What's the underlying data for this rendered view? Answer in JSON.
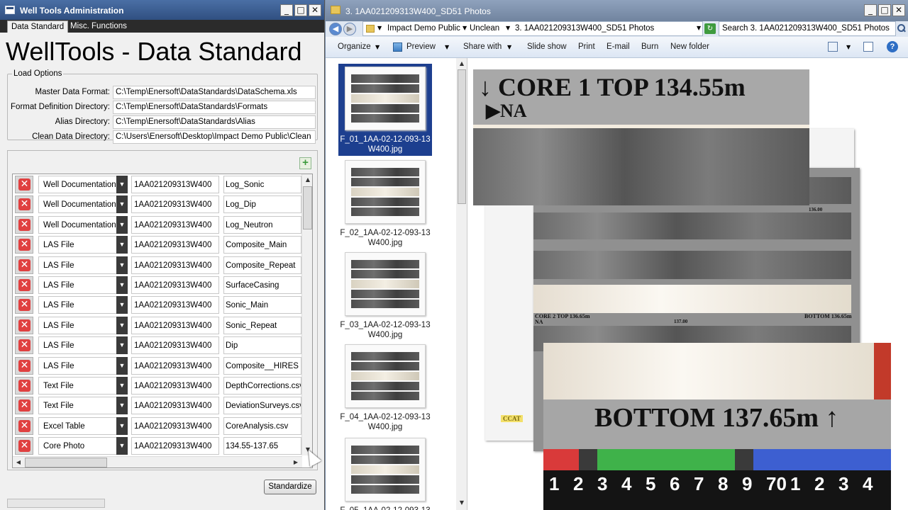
{
  "left_window": {
    "title": "Well Tools Administration",
    "tabs": [
      "Data Standard",
      "Misc. Functions"
    ],
    "app_title": "WellTools - Data Standard",
    "load_options": {
      "legend": "Load Options",
      "fields": [
        {
          "label": "Master Data Format:",
          "value": "C:\\Temp\\Enersoft\\DataStandards\\DataSchema.xls"
        },
        {
          "label": "Format Definition Directory:",
          "value": "C:\\Temp\\Enersoft\\DataStandards\\Formats"
        },
        {
          "label": "Alias Directory:",
          "value": "C:\\Temp\\Enersoft\\DataStandards\\Alias"
        },
        {
          "label": "Clean Data Directory:",
          "value": "C:\\Users\\Enersoft\\Desktop\\Impact Demo Public\\Clean"
        }
      ]
    },
    "add_button": "+",
    "rows": [
      {
        "type": "Well Documentation",
        "id": "1AA021209313W400",
        "name": "Log_Sonic"
      },
      {
        "type": "Well Documentation",
        "id": "1AA021209313W400",
        "name": "Log_Dip"
      },
      {
        "type": "Well Documentation",
        "id": "1AA021209313W400",
        "name": "Log_Neutron"
      },
      {
        "type": "LAS File",
        "id": "1AA021209313W400",
        "name": "Composite_Main"
      },
      {
        "type": "LAS File",
        "id": "1AA021209313W400",
        "name": "Composite_Repeat"
      },
      {
        "type": "LAS File",
        "id": "1AA021209313W400",
        "name": "SurfaceCasing"
      },
      {
        "type": "LAS File",
        "id": "1AA021209313W400",
        "name": "Sonic_Main"
      },
      {
        "type": "LAS File",
        "id": "1AA021209313W400",
        "name": "Sonic_Repeat"
      },
      {
        "type": "LAS File",
        "id": "1AA021209313W400",
        "name": "Dip"
      },
      {
        "type": "LAS File",
        "id": "1AA021209313W400",
        "name": "Composite__HIRES"
      },
      {
        "type": "Text File",
        "id": "1AA021209313W400",
        "name": "DepthCorrections.csv"
      },
      {
        "type": "Text File",
        "id": "1AA021209313W400",
        "name": "DeviationSurveys.csv"
      },
      {
        "type": "Excel Table",
        "id": "1AA021209313W400",
        "name": "CoreAnalysis.csv"
      },
      {
        "type": "Core Photo",
        "id": "1AA021209313W400",
        "name": "134.55-137.65"
      }
    ],
    "standardize_label": "Standardize"
  },
  "right_window": {
    "title": "3. 1AA021209313W400_SD51 Photos",
    "breadcrumbs": [
      "Impact Demo Public",
      "Unclean",
      "3. 1AA021209313W400_SD51 Photos"
    ],
    "search_placeholder": "Search 3. 1AA021209313W400_SD51 Photos",
    "toolbar": [
      "Organize",
      "Preview",
      "Share with",
      "Slide show",
      "Print",
      "E-mail",
      "Burn",
      "New folder"
    ],
    "files": [
      {
        "name": "F_01_1AA-02-12-093-13W400.jpg",
        "line1": "F_01_1AA-02-12-093-13",
        "line2": "W400.jpg",
        "selected": true
      },
      {
        "name": "F_02_1AA-02-12-093-13W400.jpg",
        "line1": "F_02_1AA-02-12-093-13",
        "line2": "W400.jpg",
        "selected": false
      },
      {
        "name": "F_03_1AA-02-12-093-13W400.jpg",
        "line1": "F_03_1AA-02-12-093-13",
        "line2": "W400.jpg",
        "selected": false
      },
      {
        "name": "F_04_1AA-02-12-093-13W400.jpg",
        "line1": "F_04_1AA-02-12-093-13",
        "line2": "W400.jpg",
        "selected": false
      },
      {
        "name": "F_05_1AA-02-12-093-13",
        "line1": "F_05_1AA-02-12-093-13",
        "line2": "",
        "selected": false
      }
    ],
    "preview": {
      "top_label": "CORE 1 TOP 134.55m",
      "na_label": "NA",
      "mid_top_label": "CORE 2 TOP 136.65m",
      "mid_bottom_label": "BOTTOM 136.65m",
      "mid_na": "NA",
      "mark_136": "136.00",
      "mark_137": "137.00",
      "bottom_label": "BOTTOM 137.65m",
      "scale_digits": [
        "1",
        "2",
        "3",
        "4",
        "5",
        "6",
        "7",
        "8",
        "9",
        "70",
        "1",
        "2",
        "3",
        "4"
      ],
      "scale_colors": [
        "#d93a3a",
        "#3a3a3a",
        "#3fb24a",
        "#3a3a3a",
        "#3d5fd1"
      ],
      "logo_text": "CCAT"
    }
  }
}
